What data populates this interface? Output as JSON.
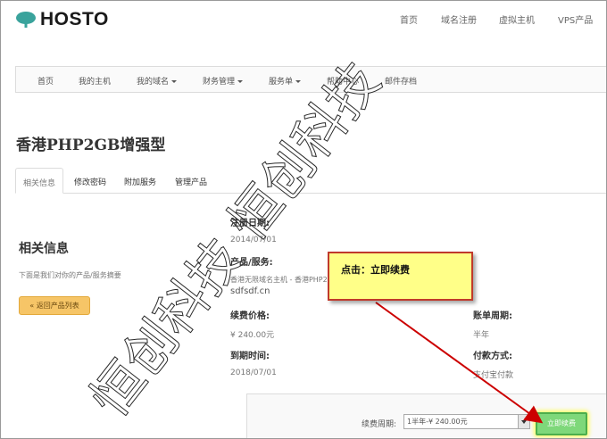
{
  "logo": {
    "text": "HOSTO",
    "icon": "cloud-tree-icon"
  },
  "top_nav": [
    {
      "id": "home",
      "label": "首页"
    },
    {
      "id": "domain-register",
      "label": "域名注册"
    },
    {
      "id": "virtual-host",
      "label": "虚拟主机"
    },
    {
      "id": "vps",
      "label": "VPS产品"
    }
  ],
  "sub_nav": [
    {
      "id": "home",
      "label": "首页",
      "dropdown": false
    },
    {
      "id": "my-hosts",
      "label": "我的主机",
      "dropdown": false
    },
    {
      "id": "my-domains",
      "label": "我的域名",
      "dropdown": true
    },
    {
      "id": "finance",
      "label": "财务管理",
      "dropdown": true
    },
    {
      "id": "tickets",
      "label": "服务单",
      "dropdown": true
    },
    {
      "id": "help",
      "label": "帮助中心",
      "dropdown": false
    },
    {
      "id": "mail",
      "label": "邮件存档",
      "dropdown": false
    }
  ],
  "page": {
    "title": "香港PHP2GB增强型"
  },
  "tabs": [
    {
      "id": "info",
      "label": "相关信息",
      "active": true
    },
    {
      "id": "password",
      "label": "修改密码",
      "active": false
    },
    {
      "id": "addons",
      "label": "附加服务",
      "active": false
    },
    {
      "id": "manage",
      "label": "管理产品",
      "active": false
    }
  ],
  "section": {
    "title": "相关信息",
    "description": "下面是我们对你的产品/服务摘要",
    "back_button": "« 返回产品列表"
  },
  "details": {
    "reg_date_label": "注册日期:",
    "reg_date_value": "2014/07/01",
    "product_label": "产品/服务:",
    "product_value": "香港无限域名主机 - 香港PHP2GB增强型",
    "domain_value": "sdfsdf.cn",
    "price_label": "续费价格:",
    "price_value": "¥ 240.00元",
    "cycle_label": "账单周期:",
    "cycle_value": "半年",
    "expire_label": "到期时间:",
    "expire_value": "2018/07/01",
    "payment_label": "付款方式:",
    "payment_value": "支付宝付款"
  },
  "callout": {
    "text": "点击：立即续费"
  },
  "renewal": {
    "period_label": "续费周期:",
    "period_selected": "1半年-¥ 240.00元",
    "button": "立即续费"
  },
  "watermark": {
    "text": "恒创科技 恒创科技"
  },
  "colors": {
    "back_button": "#f6c567",
    "renew_button": "#7ed87a",
    "callout_bg": "#ffff88",
    "callout_border": "#c0392b",
    "arrow": "#cc0000"
  }
}
